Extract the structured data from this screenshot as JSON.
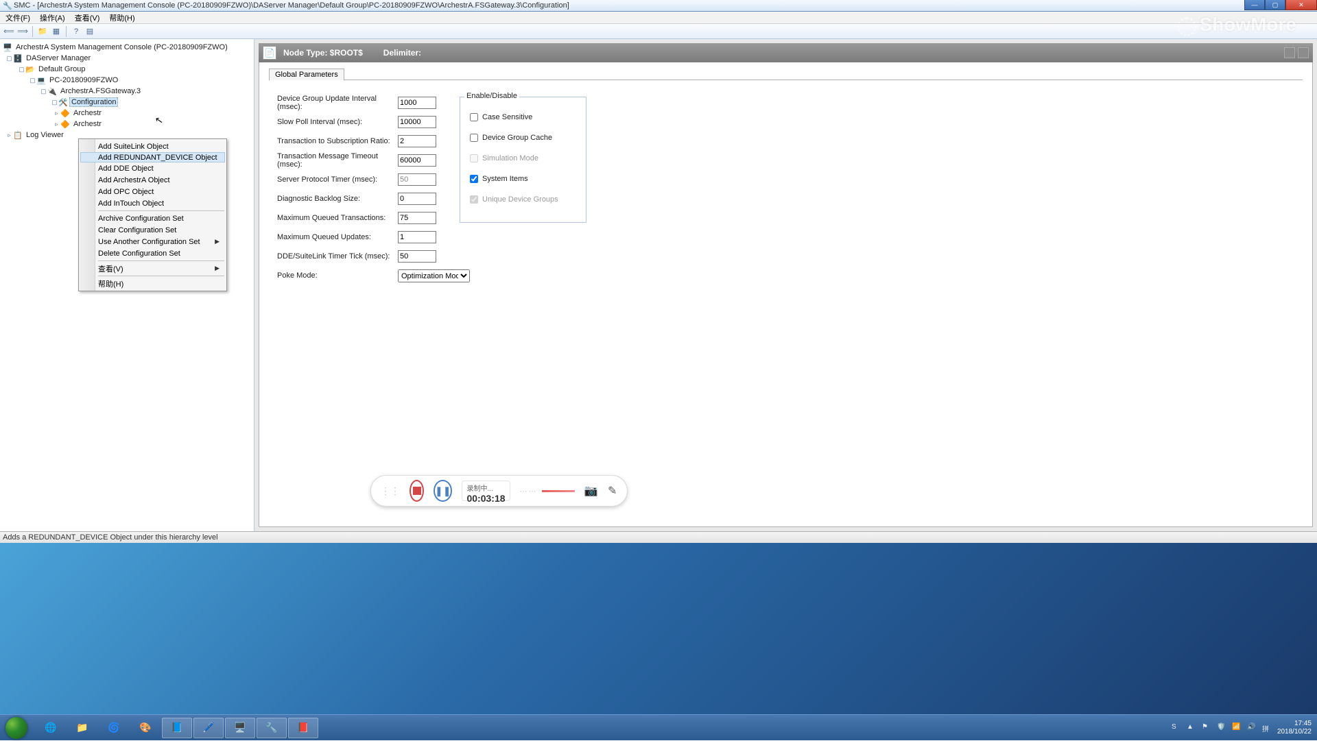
{
  "title": "SMC - [ArchestrA System Management Console (PC-20180909FZWO)\\DAServer Manager\\Default Group\\PC-20180909FZWO\\ArchestrA.FSGateway.3\\Configuration]",
  "menubar": [
    "文件(F)",
    "操作(A)",
    "查看(V)",
    "帮助(H)"
  ],
  "tree": {
    "root": "ArchestrA System Management Console (PC-20180909FZWO)",
    "daserver": "DAServer Manager",
    "defgroup": "Default Group",
    "pc": "PC-20180909FZWO",
    "fsgw": "ArchestrA.FSGateway.3",
    "config": "Configuration",
    "arch1": "Archestr",
    "arch2": "Archestr",
    "logviewer": "Log Viewer"
  },
  "ctx": {
    "items": [
      "Add SuiteLink Object",
      "Add REDUNDANT_DEVICE Object",
      "Add DDE Object",
      "Add ArchestrA Object",
      "Add OPC Object",
      "Add InTouch Object"
    ],
    "group2": [
      "Archive Configuration Set",
      "Clear Configuration Set",
      "Use Another Configuration Set",
      "Delete Configuration Set"
    ],
    "group3": [
      "查看(V)"
    ],
    "group4": [
      "帮助(H)"
    ]
  },
  "header": {
    "nodetype_label": "Node Type: ",
    "nodetype": "$ROOT$",
    "delimiter_label": "Delimiter:"
  },
  "tab": "Global Parameters",
  "form": {
    "l_update": "Device Group Update Interval (msec):",
    "v_update": "1000",
    "l_slow": "Slow Poll Interval (msec):",
    "v_slow": "10000",
    "l_t2s": "Transaction to Subscription Ratio:",
    "v_t2s": "2",
    "l_tmt": "Transaction Message Timeout (msec):",
    "v_tmt": "60000",
    "l_spt": "Server Protocol Timer (msec):",
    "v_spt": "50",
    "l_dbl": "Diagnostic Backlog Size:",
    "v_dbl": "0",
    "l_mqt": "Maximum Queued Transactions:",
    "v_mqt": "75",
    "l_mqu": "Maximum Queued Updates:",
    "v_mqu": "1",
    "l_dde": "DDE/SuiteLink Timer Tick (msec):",
    "v_dde": "50",
    "l_poke": "Poke Mode:",
    "v_poke": "Optimization Mode"
  },
  "enable": {
    "legend": "Enable/Disable",
    "case": "Case Sensitive",
    "cache": "Device Group Cache",
    "sim": "Simulation Mode",
    "sys": "System Items",
    "uniq": "Unique Device Groups"
  },
  "status": "Adds a REDUNDANT_DEVICE Object under this hierarchy level",
  "recorder": {
    "status": "录制中...",
    "time": "00:03:18"
  },
  "watermark": "ShowMore",
  "clock": {
    "time": "17:45",
    "date": "2018/10/22"
  }
}
